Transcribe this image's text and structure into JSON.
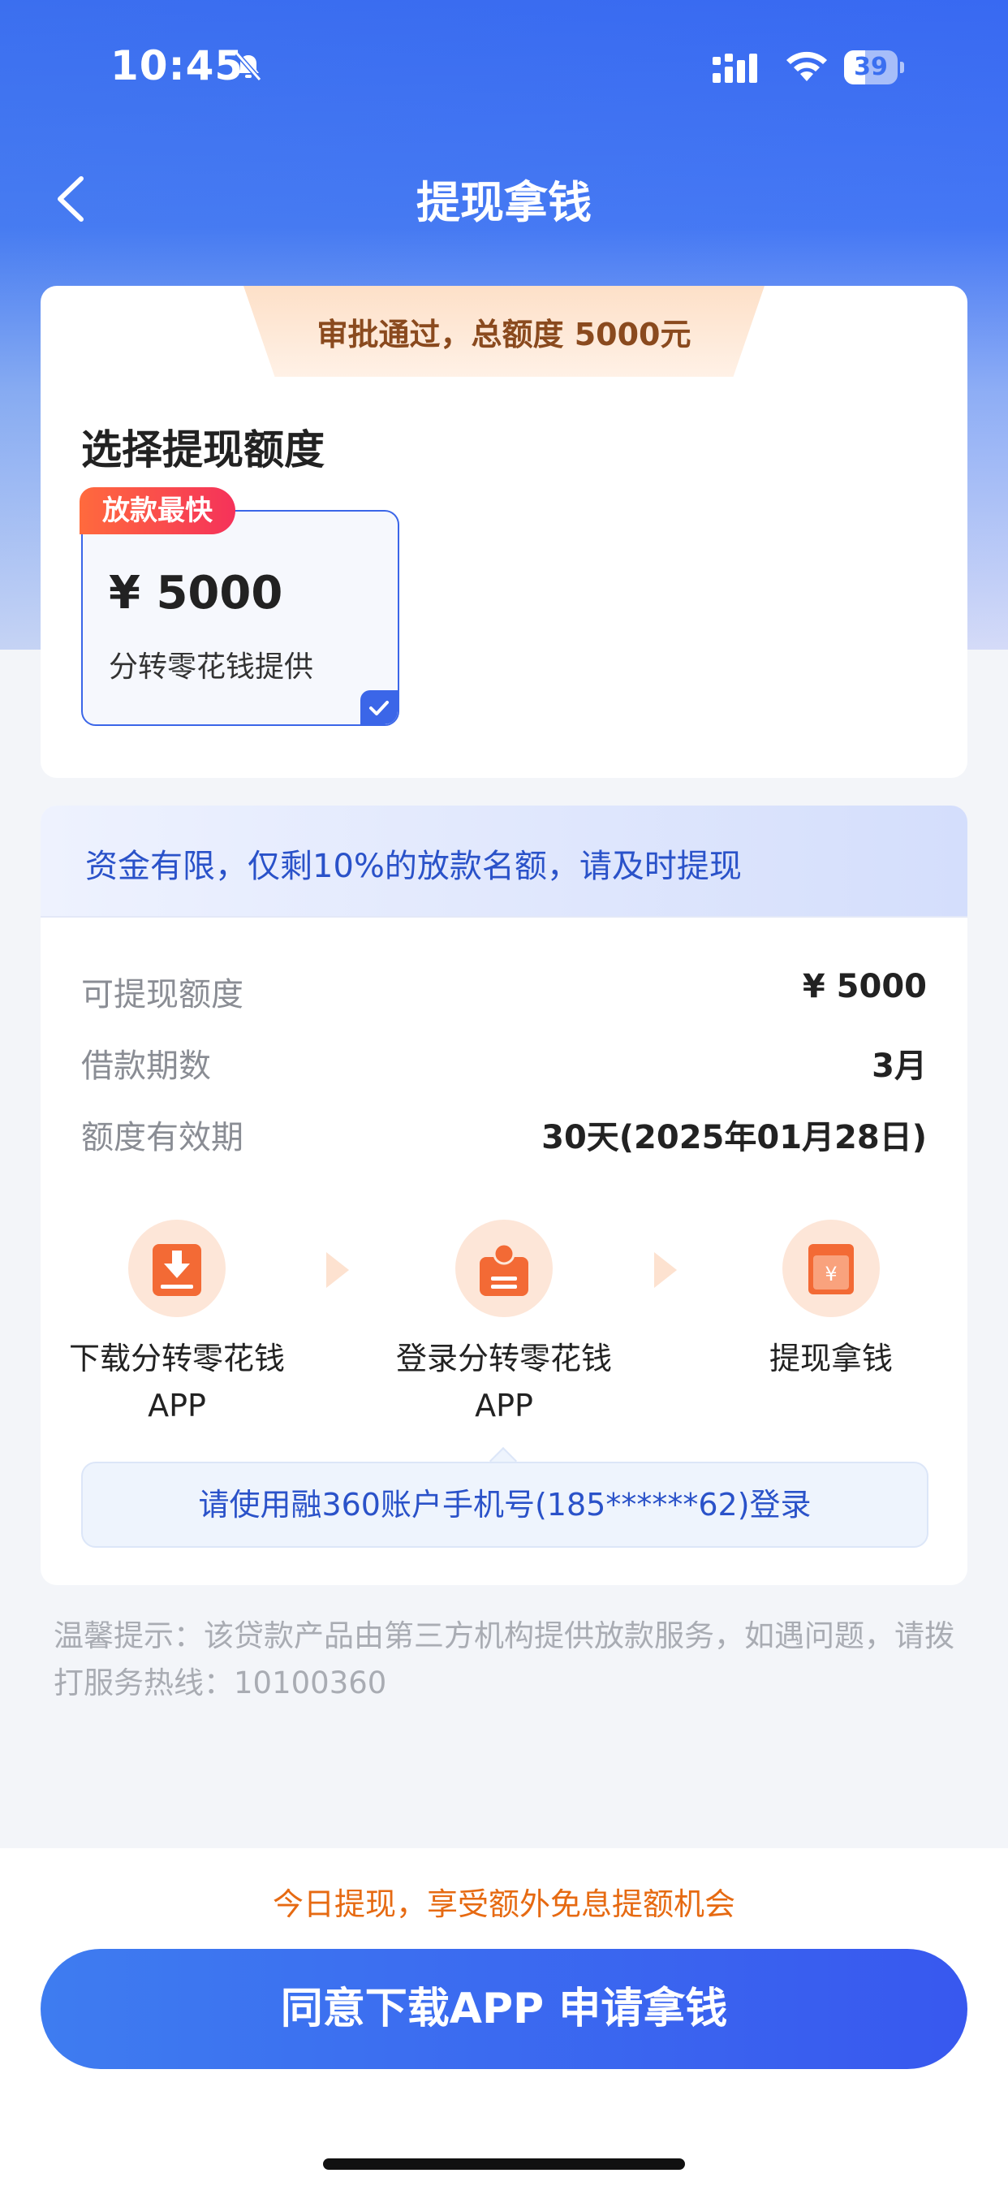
{
  "status_bar": {
    "time": "10:45",
    "battery": "39",
    "battery_level": 0.39
  },
  "nav": {
    "title": "提现拿钱"
  },
  "approval": {
    "banner": "审批通过，总额度 5000元"
  },
  "selection": {
    "title": "选择提现额度",
    "badge": "放款最快",
    "amount": "¥ 5000",
    "provider": "分转零花钱提供",
    "selected": true
  },
  "notice": {
    "text": "资金有限，仅剩10%的放款名额，请及时提现"
  },
  "details": [
    {
      "label": "可提现额度",
      "value": "¥ 5000"
    },
    {
      "label": "借款期数",
      "value": "3月"
    },
    {
      "label": "额度有效期",
      "value": "30天(2025年01月28日)"
    }
  ],
  "steps": [
    {
      "label": "下载分转零花钱APP",
      "icon": "download-icon"
    },
    {
      "label": "登录分转零花钱APP",
      "icon": "login-user-icon"
    },
    {
      "label": "提现拿钱",
      "icon": "cash-icon"
    }
  ],
  "login_tip": "请使用融360账户手机号(185******62)登录",
  "warm_tip": "温馨提示：该贷款产品由第三方机构提供放款服务，如遇问题，请拨打服务热线：10100360",
  "promo": "今日提现，享受额外免息提额机会",
  "cta": "同意下载APP 申请拿钱",
  "colors": {
    "primary": "#3b66e8",
    "accent_orange": "#e66a12",
    "badge_red": "#f5325a"
  }
}
